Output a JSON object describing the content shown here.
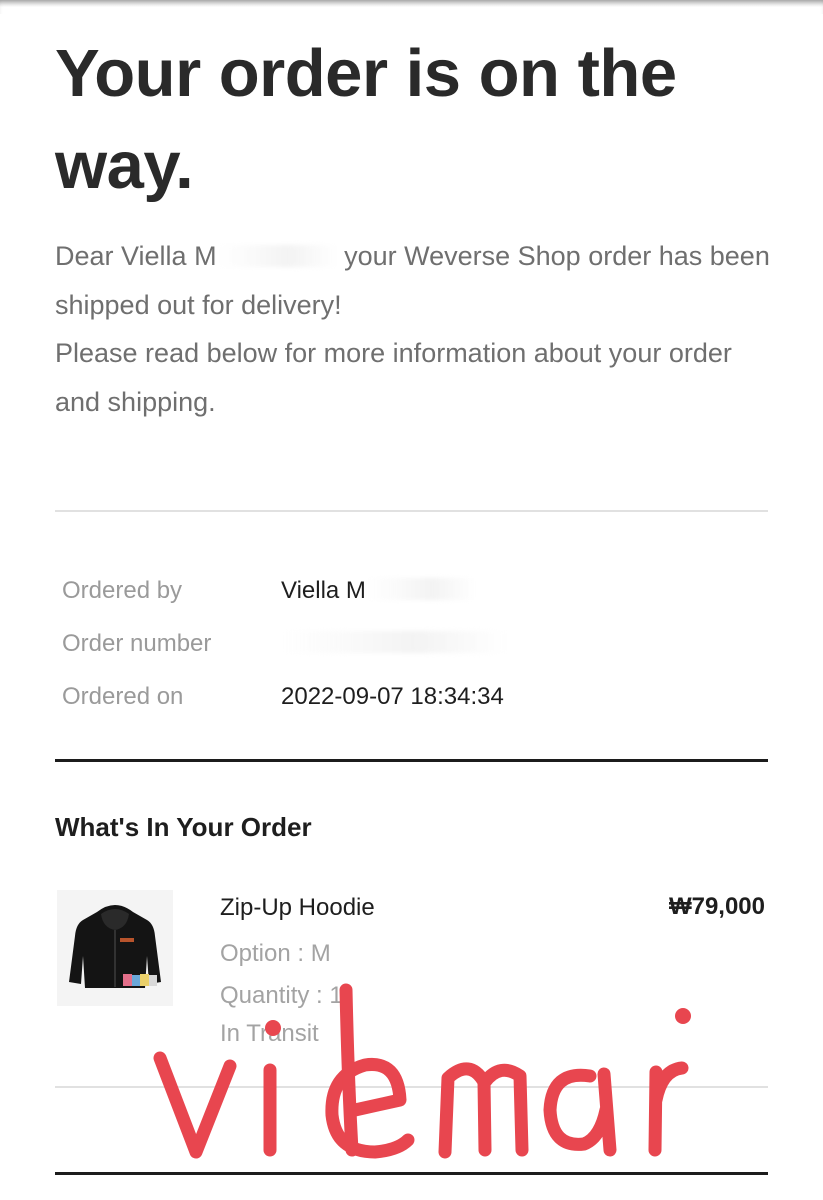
{
  "email": {
    "headline": "Your order is on the way.",
    "intro": {
      "greeting_prefix": "Dear Viella M",
      "greeting_suffix": " your Weverse Shop order has been shipped out for delivery!",
      "line2": "Please read below for more information about your order and shipping."
    },
    "order_info": {
      "ordered_by_label": "Ordered by",
      "ordered_by_value": "Viella M",
      "order_number_label": "Order number",
      "order_number_value": "",
      "ordered_on_label": "Ordered on",
      "ordered_on_value": "2022-09-07 18:34:34"
    },
    "order_section": {
      "title": "What's In Your Order",
      "item": {
        "name": "Zip-Up Hoodie",
        "option": "Option : M",
        "quantity": "Quantity : 1",
        "status": "In Transit",
        "price": "₩79,000",
        "thumbnail_icon": "hoodie-image"
      }
    },
    "watermark": {
      "text": "vielmari",
      "color": "#e8464f"
    }
  },
  "colors": {
    "headline": "#2a2a2a",
    "body_text": "#6f6f6f",
    "label": "#9a9a9a",
    "value": "#1e1e1e"
  }
}
